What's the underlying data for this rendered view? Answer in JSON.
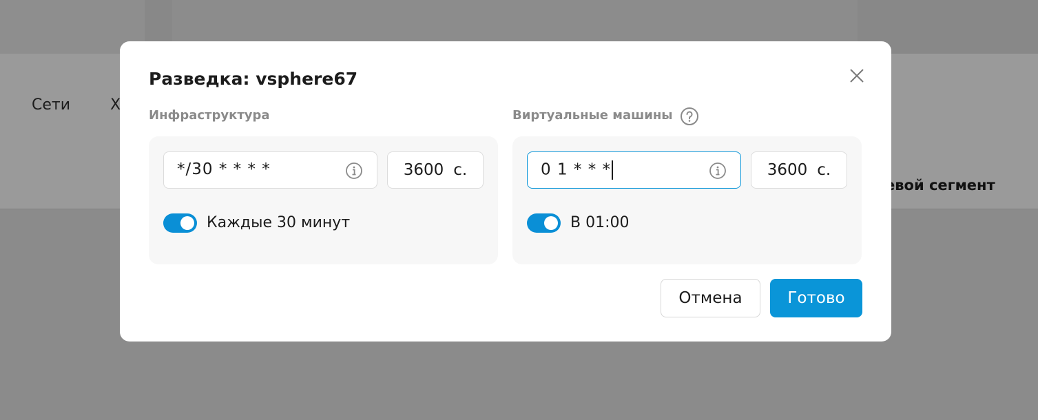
{
  "background": {
    "tabs": [
      "Сети",
      "Х"
    ],
    "column_header": "евой сегмент"
  },
  "modal": {
    "title": "Разведка: vsphere67",
    "infrastructure": {
      "label": "Инфраструктура",
      "cron": "*/30 * * * *",
      "seconds": "3600",
      "unit": "с.",
      "toggle_on": true,
      "toggle_label": "Каждые 30 минут"
    },
    "vms": {
      "label": "Виртуальные машины",
      "cron": "0 1 * * *",
      "seconds": "3600",
      "unit": "с.",
      "toggle_on": true,
      "toggle_label": "В 01:00"
    },
    "cancel_label": "Отмена",
    "ok_label": "Готово"
  },
  "colors": {
    "accent": "#0a95d8",
    "overlay": "#8a8a8a",
    "panel": "#f7f7f7"
  }
}
